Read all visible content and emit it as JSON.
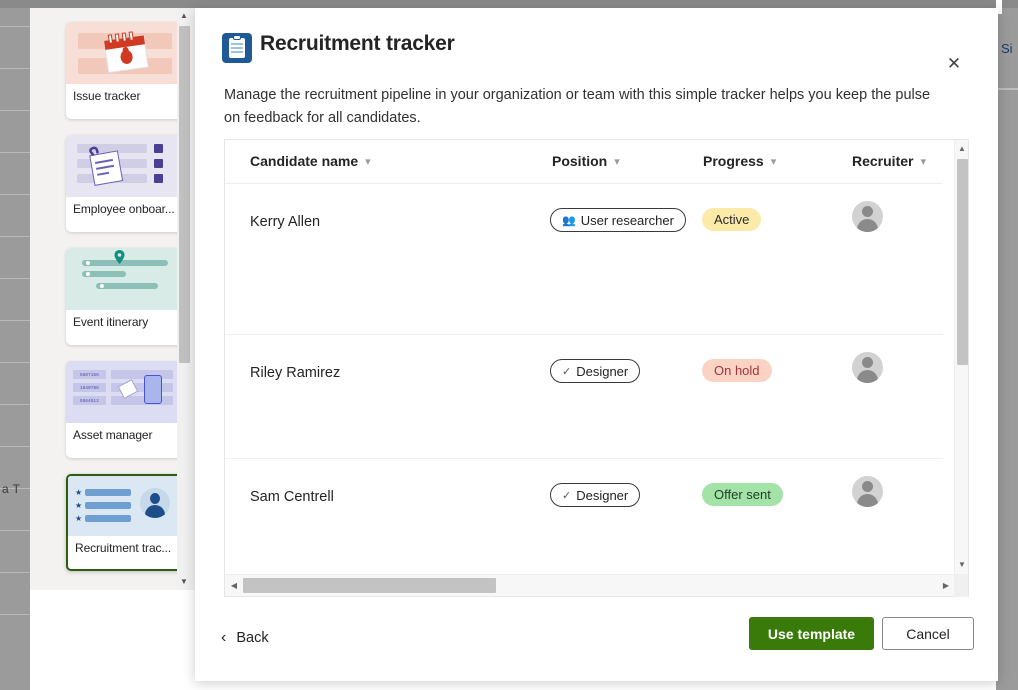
{
  "background": {
    "left_text": "a T",
    "right_text": "Si"
  },
  "sidebar": {
    "scroll_up_icon": "chevron-up-icon",
    "scroll_down_icon": "chevron-down-icon",
    "templates": [
      {
        "label": "Issue tracker",
        "selected": false
      },
      {
        "label": "Employee onboar...",
        "selected": false
      },
      {
        "label": "Event itinerary",
        "selected": false
      },
      {
        "label": "Asset manager",
        "selected": false
      },
      {
        "label": "Recruitment trac...",
        "selected": true
      }
    ],
    "asset_codes": [
      "5687156",
      "1649786",
      "5564512"
    ]
  },
  "dialog": {
    "icon": "clipboard-icon",
    "title": "Recruitment tracker",
    "close_label": "✕",
    "description": "Manage the recruitment pipeline in your organization or team with this simple tracker helps you keep the pulse on feedback for all candidates."
  },
  "table": {
    "columns": [
      {
        "label": "Candidate name",
        "sort_icon": "chevron-down-icon"
      },
      {
        "label": "Position",
        "sort_icon": "chevron-down-icon"
      },
      {
        "label": "Progress",
        "sort_icon": "chevron-down-icon"
      },
      {
        "label": "Recruiter",
        "sort_icon": "chevron-down-icon"
      }
    ],
    "rows": [
      {
        "name": "Kerry Allen",
        "position": "User researcher",
        "position_icon": "people-icon",
        "progress": "Active",
        "progress_state": "active",
        "recruiter_avatar": "person-avatar-icon"
      },
      {
        "name": "Riley Ramirez",
        "position": "Designer",
        "position_icon": "check-icon",
        "progress": "On hold",
        "progress_state": "hold",
        "recruiter_avatar": "person-avatar-icon"
      },
      {
        "name": "Sam Centrell",
        "position": "Designer",
        "position_icon": "check-icon",
        "progress": "Offer sent",
        "progress_state": "offer",
        "recruiter_avatar": "person-avatar-icon"
      }
    ]
  },
  "footer": {
    "back_label": "Back",
    "back_icon": "chevron-left-icon",
    "use_template_label": "Use template",
    "cancel_label": "Cancel"
  },
  "colors": {
    "primary_green": "#3a7a0b",
    "selected_border": "#2c5e0e",
    "badge_active": "#fbeaa8",
    "badge_hold": "#fbd3c4",
    "badge_offer": "#a4e3a7",
    "app_icon_blue": "#1f5a96"
  }
}
